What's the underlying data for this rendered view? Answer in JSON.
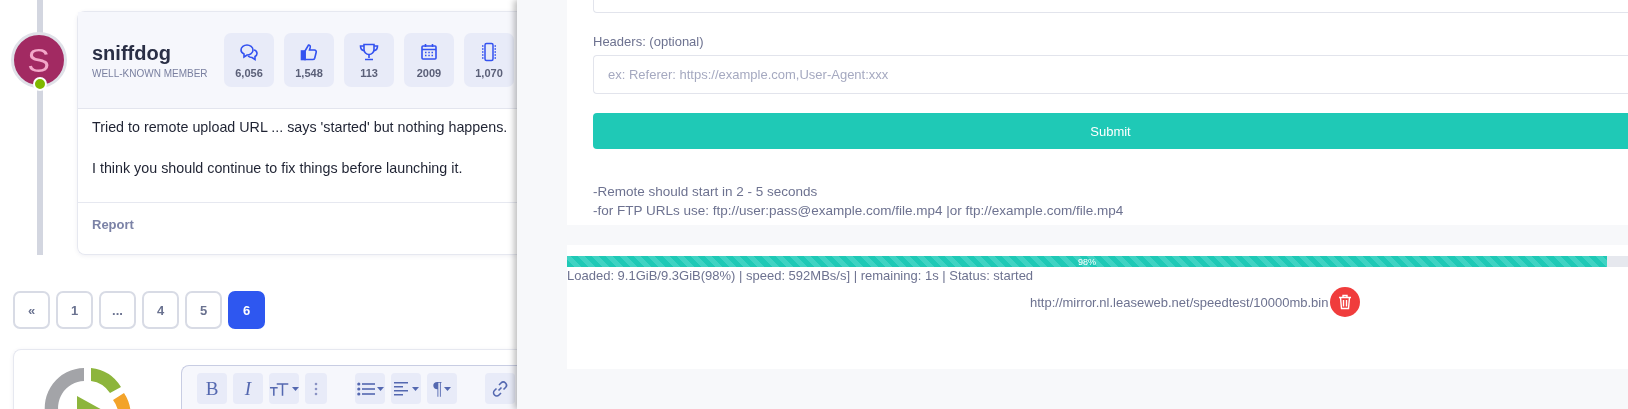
{
  "post": {
    "avatar_letter": "S",
    "online": true,
    "username": "sniffdog",
    "role": "WELL-KNOWN MEMBER",
    "stats": [
      "6,056",
      "1,548",
      "113",
      "2009",
      "1,070"
    ],
    "body": [
      "Tried to remote upload URL ... says 'started' but nothing happens.",
      "I think you should continue to fix things before launching it."
    ],
    "report": "Report"
  },
  "pagination": [
    {
      "label": "«",
      "selected": false
    },
    {
      "label": "1",
      "selected": false
    },
    {
      "label": "...",
      "selected": false
    },
    {
      "label": "4",
      "selected": false
    },
    {
      "label": "5",
      "selected": false
    },
    {
      "label": "6",
      "selected": true
    }
  ],
  "editor_toolbar": [
    {
      "kind": "bold",
      "label": "B",
      "has_menu": false
    },
    {
      "kind": "italic",
      "label": "I",
      "has_menu": false
    },
    {
      "kind": "size",
      "has_menu": true
    },
    {
      "kind": "more",
      "has_menu": false
    },
    {
      "kind": "list",
      "has_menu": true
    },
    {
      "kind": "align",
      "has_menu": true
    },
    {
      "kind": "plain",
      "label": "¶",
      "has_menu": true
    },
    {
      "kind": "link",
      "has_menu": false
    }
  ],
  "remote_form": {
    "headers_label": "Headers: (optional)",
    "headers_placeholder": "ex: Referer: https://example.com,User-Agent:xxx",
    "submit": "Submit",
    "notes": [
      "-Remote should start in 2 - 5 seconds",
      "-for FTP URLs use: ftp://user:pass@example.com/file.mp4 |or ftp://example.com/file.mp4"
    ]
  },
  "transfer": {
    "level": 0.98,
    "percent": "98%",
    "status": "Loaded: 9.1GiB/9.3GiB(98%) | speed: 592MBs/s] | remaining: 1s | Status: started",
    "url": "http://mirror.nl.leaseweb.net/speedtest/10000mb.bin"
  }
}
